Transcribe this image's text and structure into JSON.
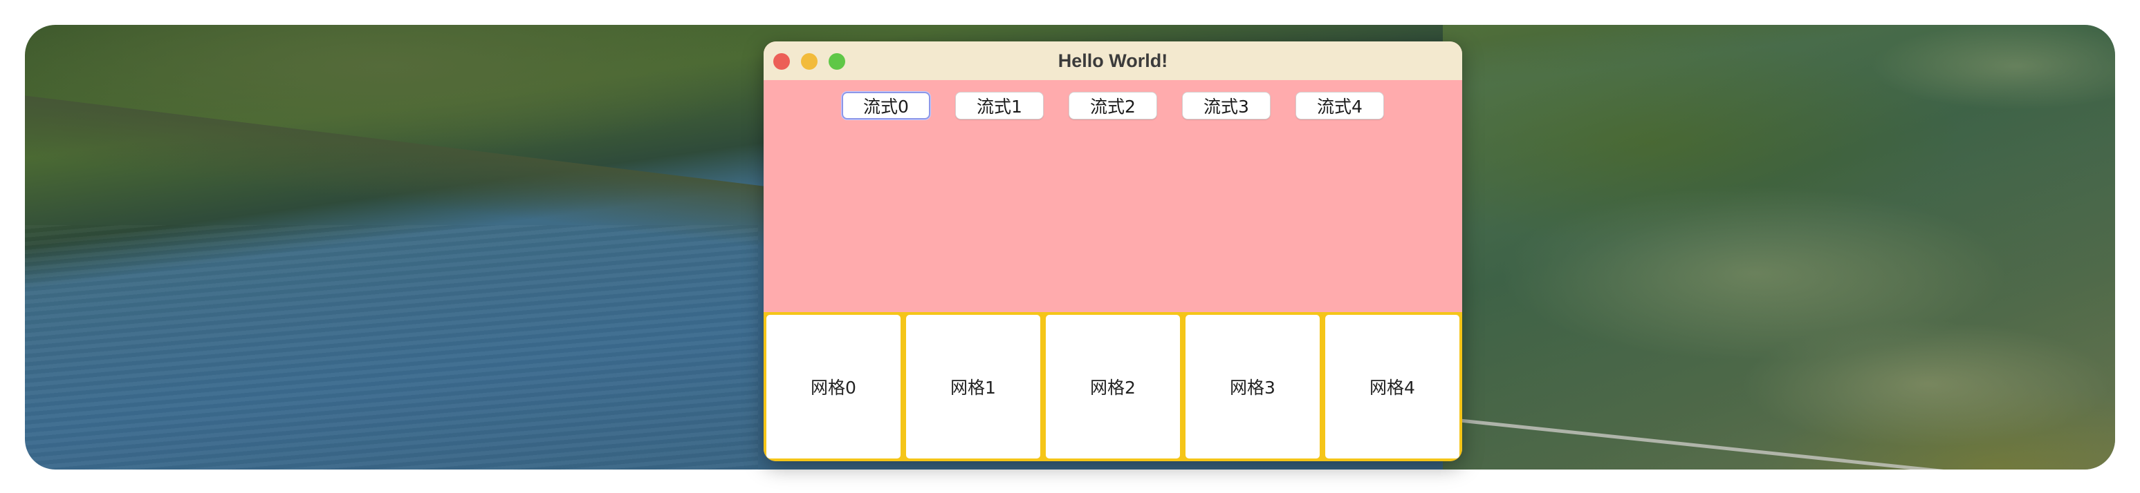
{
  "window": {
    "title": "Hello World!"
  },
  "flow": {
    "buttons": [
      "流式0",
      "流式1",
      "流式2",
      "流式3",
      "流式4"
    ],
    "focused_index": 0
  },
  "grid": {
    "cells": [
      "网格0",
      "网格1",
      "网格2",
      "网格3",
      "网格4"
    ]
  },
  "colors": {
    "flow_bg": "#ffabad",
    "grid_bg": "#f5c518",
    "titlebar_bg": "#f3e9cf",
    "close": "#ec5f57",
    "minimize": "#f2bb3b",
    "maximize": "#5fc747"
  }
}
